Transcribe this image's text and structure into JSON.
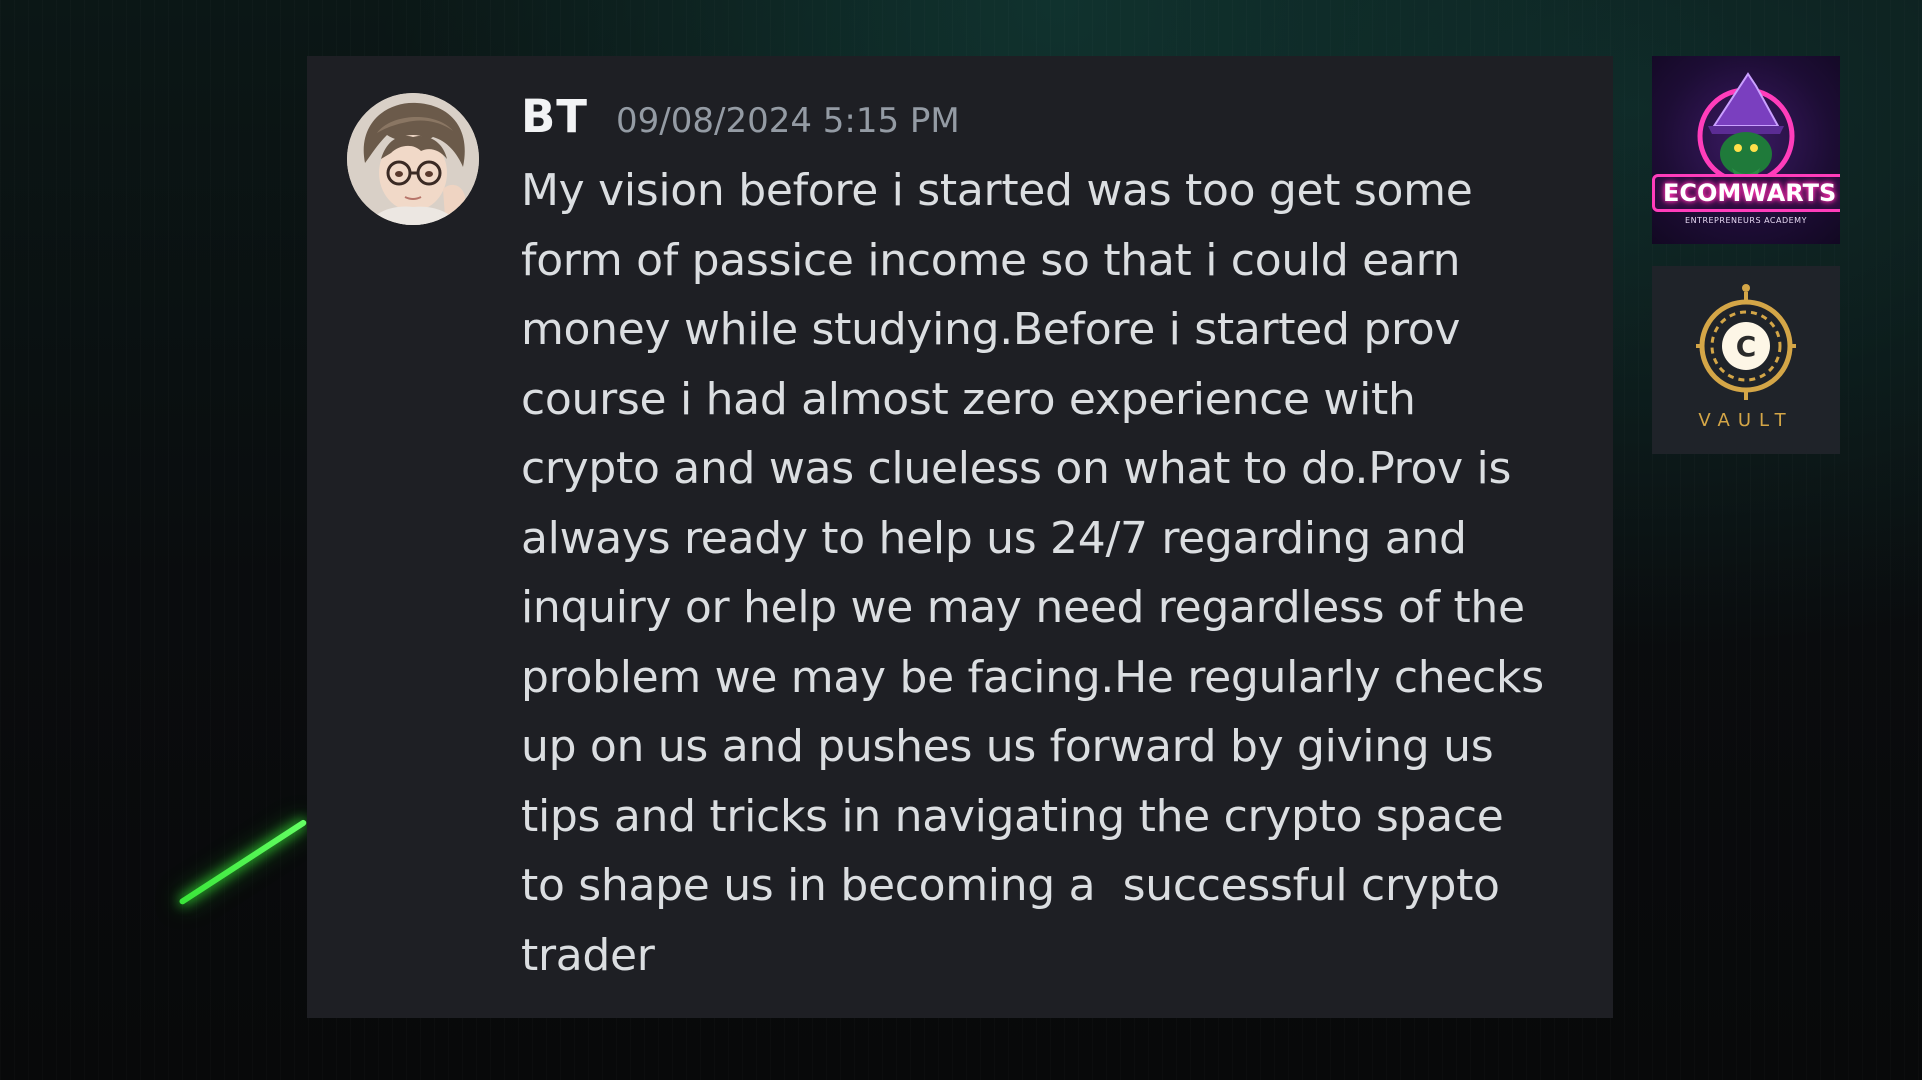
{
  "message": {
    "username": "BT",
    "timestamp": "09/08/2024 5:15 PM",
    "lines": [
      "My vision before i started was too get some",
      "form of passice income so that i could earn",
      "money while studying.Before i started prov",
      "course i had almost zero experience with",
      "crypto and was clueless on what to do.Prov is",
      "always ready to help us 24/7 regarding and",
      "inquiry or help we may need regardless of the",
      "problem we may be facing.He regularly checks",
      "up on us and pushes us forward by giving us",
      "tips and tricks in navigating the crypto space",
      "to shape us in becoming a  successful crypto",
      "trader"
    ]
  },
  "logos": {
    "ecomwarts": {
      "name": "ECOMWARTS",
      "tagline": "ENTREPRENEURS ACADEMY",
      "icon": "wizard-hat-icon",
      "accent": "#ff3dbb"
    },
    "vault": {
      "name": "VAULT",
      "icon": "coin-c-icon",
      "accent": "#d4a647"
    }
  },
  "colors": {
    "card_bg": "#1e1f24",
    "text": "#dbdee1",
    "username": "#f2f3f5",
    "timestamp": "#949ba4",
    "streak": "#39e639"
  }
}
